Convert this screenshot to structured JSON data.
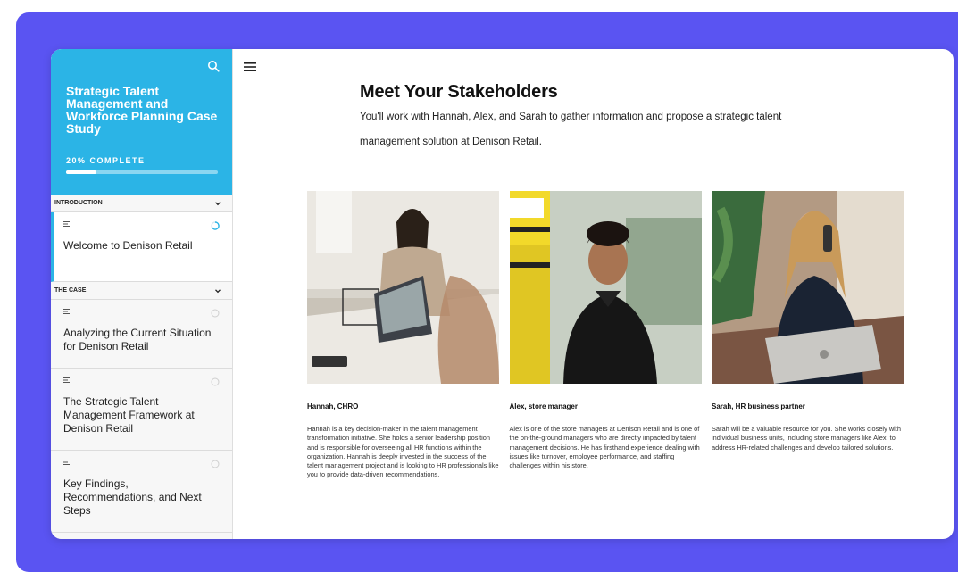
{
  "sidebar": {
    "title": "Strategic Talent Management and Workforce Planning Case Study",
    "progress_label": "20% COMPLETE",
    "progress_fraction": 0.2,
    "sections": [
      {
        "label": "INTRODUCTION",
        "lessons": [
          {
            "title": "Welcome to Denison Retail",
            "status": "in-progress",
            "active": true
          }
        ]
      },
      {
        "label": "THE CASE",
        "lessons": [
          {
            "title": "Analyzing the Current Situation for Denison Retail",
            "status": "not-started",
            "active": false
          },
          {
            "title": "The Strategic Talent Management Framework at Denison Retail",
            "status": "not-started",
            "active": false
          },
          {
            "title": "Key Findings, Recommendations, and Next Steps",
            "status": "not-started",
            "active": false
          }
        ]
      }
    ]
  },
  "main": {
    "title": "Meet Your Stakeholders",
    "subtitle": "You'll work with Hannah, Alex, and Sarah to gather information and propose a strategic talent management solution at Denison Retail."
  },
  "stakeholders": [
    {
      "name": "Hannah, CHRO",
      "description": "Hannah is a key decision-maker in the talent management transformation initiative. She holds a senior leadership position and is responsible for overseeing all HR functions within the organization. Hannah is deeply invested in the success of the talent management project and is looking to HR professionals like you to provide data-driven recommendations."
    },
    {
      "name": "Alex, store manager",
      "description": "Alex is one of the store managers at Denison Retail and is one of the on-the-ground managers who are directly impacted by talent management decisions. He has firsthand experience dealing with issues like turnover, employee performance, and staffing challenges within his store."
    },
    {
      "name": "Sarah, HR business partner",
      "description": "Sarah will be a valuable resource for you. She works closely with individual business units, including store managers like Alex, to address HR-related challenges and develop tailored solutions."
    }
  ],
  "icons": {
    "search": "search-icon",
    "menu": "hamburger-menu-icon",
    "chevron": "chevron-down-icon",
    "lesson": "lesson-text-icon"
  },
  "colors": {
    "frame": "#5a54f2",
    "accent": "#2bb4e6"
  }
}
